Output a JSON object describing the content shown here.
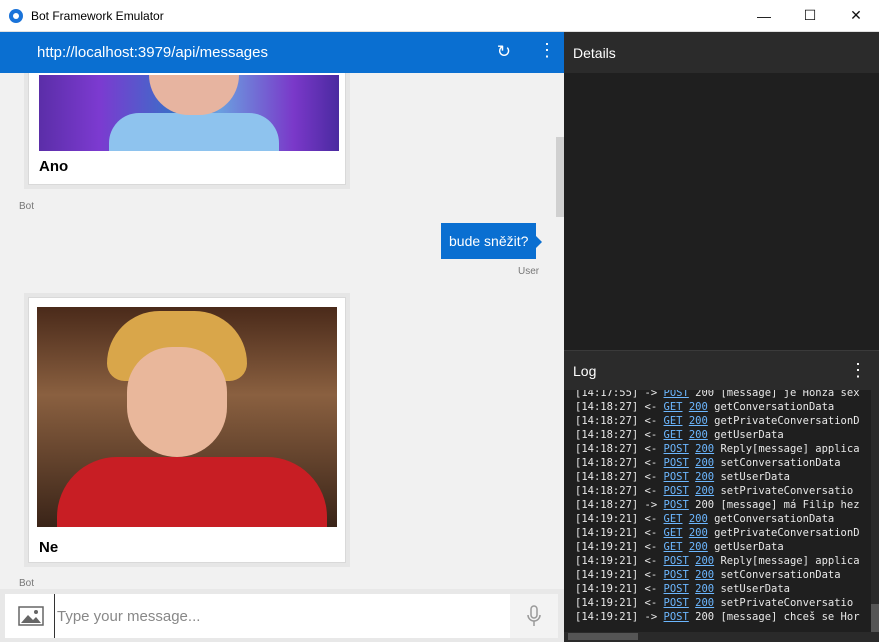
{
  "window": {
    "title": "Bot Framework Emulator",
    "minimize_glyph": "—",
    "maximize_glyph": "☐",
    "close_glyph": "✕"
  },
  "address_bar": {
    "url": "http://localhost:3979/api/messages",
    "refresh_icon": "↻",
    "more_icon": "⋮"
  },
  "chat": {
    "messages": [
      {
        "from": "bot",
        "card_title": "Ano",
        "sender_label": "Bot"
      },
      {
        "from": "user",
        "text": "bude sněžit?",
        "sender_label": "User"
      },
      {
        "from": "bot",
        "card_title": "Ne",
        "sender_label": "Bot"
      }
    ],
    "input_placeholder": "Type your message..."
  },
  "details": {
    "title": "Details"
  },
  "log": {
    "title": "Log",
    "more_icon": "⋮",
    "entries": [
      {
        "time": "[14:17:55]",
        "dir": "->",
        "method": "POST",
        "status": "200",
        "text": "[message] je Honza sex"
      },
      {
        "time": "[14:18:27]",
        "dir": "<-",
        "method": "GET",
        "status": "200",
        "text": "getConversationData"
      },
      {
        "time": "[14:18:27]",
        "dir": "<-",
        "method": "GET",
        "status": "200",
        "text": "getPrivateConversationD"
      },
      {
        "time": "[14:18:27]",
        "dir": "<-",
        "method": "GET",
        "status": "200",
        "text": "getUserData"
      },
      {
        "time": "[14:18:27]",
        "dir": "<-",
        "method": "POST",
        "status": "200",
        "text": "Reply[message] applica"
      },
      {
        "time": "[14:18:27]",
        "dir": "<-",
        "method": "POST",
        "status": "200",
        "text": "setConversationData"
      },
      {
        "time": "[14:18:27]",
        "dir": "<-",
        "method": "POST",
        "status": "200",
        "text": "setUserData"
      },
      {
        "time": "[14:18:27]",
        "dir": "<-",
        "method": "POST",
        "status": "200",
        "text": "setPrivateConversatio"
      },
      {
        "time": "[14:18:27]",
        "dir": "->",
        "method": "POST",
        "status": "200",
        "text": "[message] má Filip hez"
      },
      {
        "time": "[14:19:21]",
        "dir": "<-",
        "method": "GET",
        "status": "200",
        "text": "getConversationData"
      },
      {
        "time": "[14:19:21]",
        "dir": "<-",
        "method": "GET",
        "status": "200",
        "text": "getPrivateConversationD"
      },
      {
        "time": "[14:19:21]",
        "dir": "<-",
        "method": "GET",
        "status": "200",
        "text": "getUserData"
      },
      {
        "time": "[14:19:21]",
        "dir": "<-",
        "method": "POST",
        "status": "200",
        "text": "Reply[message] applica"
      },
      {
        "time": "[14:19:21]",
        "dir": "<-",
        "method": "POST",
        "status": "200",
        "text": "setConversationData"
      },
      {
        "time": "[14:19:21]",
        "dir": "<-",
        "method": "POST",
        "status": "200",
        "text": "setUserData"
      },
      {
        "time": "[14:19:21]",
        "dir": "<-",
        "method": "POST",
        "status": "200",
        "text": "setPrivateConversatio"
      },
      {
        "time": "[14:19:21]",
        "dir": "->",
        "method": "POST",
        "status": "200",
        "text": "[message] chceš se Hor"
      }
    ]
  },
  "colors": {
    "accent": "#0a6fd1",
    "panel_dark": "#1f1f1f",
    "log_link": "#6cb7ff"
  }
}
